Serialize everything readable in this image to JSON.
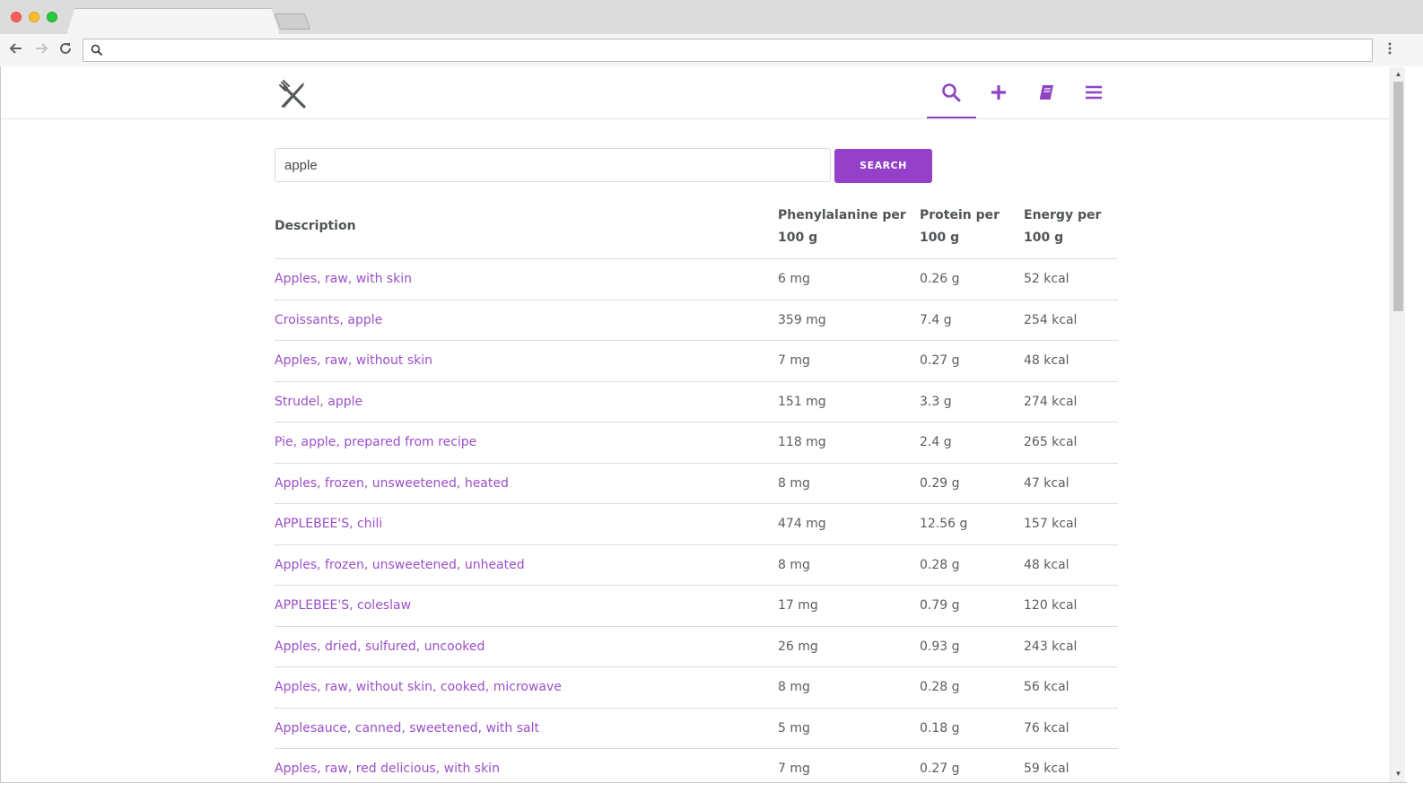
{
  "browser": {
    "tab_title": "",
    "address": ""
  },
  "colors": {
    "accent": "#9440c8",
    "link": "#9b4fc9",
    "text": "#5c5c5c",
    "header_text": "#4f5457"
  },
  "nav": {
    "logo_icon": "fork-knife-crossed-icon",
    "items": [
      {
        "icon": "search-icon",
        "active": true
      },
      {
        "icon": "plus-icon",
        "active": false
      },
      {
        "icon": "book-icon",
        "active": false
      },
      {
        "icon": "hamburger-menu-icon",
        "active": false
      }
    ]
  },
  "search": {
    "value": "apple",
    "button_label": "SEARCH"
  },
  "table": {
    "headers": {
      "description": "Description",
      "phenylalanine": "Phenylalanine per 100 g",
      "protein": "Protein per 100 g",
      "energy": "Energy per 100 g"
    },
    "rows": [
      {
        "description": "Apples, raw, with skin",
        "phenylalanine": "6 mg",
        "protein": "0.26 g",
        "energy": "52 kcal"
      },
      {
        "description": "Croissants, apple",
        "phenylalanine": "359 mg",
        "protein": "7.4 g",
        "energy": "254 kcal"
      },
      {
        "description": "Apples, raw, without skin",
        "phenylalanine": "7 mg",
        "protein": "0.27 g",
        "energy": "48 kcal"
      },
      {
        "description": "Strudel, apple",
        "phenylalanine": "151 mg",
        "protein": "3.3 g",
        "energy": "274 kcal"
      },
      {
        "description": "Pie, apple, prepared from recipe",
        "phenylalanine": "118 mg",
        "protein": "2.4 g",
        "energy": "265 kcal"
      },
      {
        "description": "Apples, frozen, unsweetened, heated",
        "phenylalanine": "8 mg",
        "protein": "0.29 g",
        "energy": "47 kcal"
      },
      {
        "description": "APPLEBEE'S, chili",
        "phenylalanine": "474 mg",
        "protein": "12.56 g",
        "energy": "157 kcal"
      },
      {
        "description": "Apples, frozen, unsweetened, unheated",
        "phenylalanine": "8 mg",
        "protein": "0.28 g",
        "energy": "48 kcal"
      },
      {
        "description": "APPLEBEE'S, coleslaw",
        "phenylalanine": "17 mg",
        "protein": "0.79 g",
        "energy": "120 kcal"
      },
      {
        "description": "Apples, dried, sulfured, uncooked",
        "phenylalanine": "26 mg",
        "protein": "0.93 g",
        "energy": "243 kcal"
      },
      {
        "description": "Apples, raw, without skin, cooked, microwave",
        "phenylalanine": "8 mg",
        "protein": "0.28 g",
        "energy": "56 kcal"
      },
      {
        "description": "Applesauce, canned, sweetened, with salt",
        "phenylalanine": "5 mg",
        "protein": "0.18 g",
        "energy": "76 kcal"
      },
      {
        "description": "Apples, raw, red delicious, with skin",
        "phenylalanine": "7 mg",
        "protein": "0.27 g",
        "energy": "59 kcal"
      }
    ]
  }
}
